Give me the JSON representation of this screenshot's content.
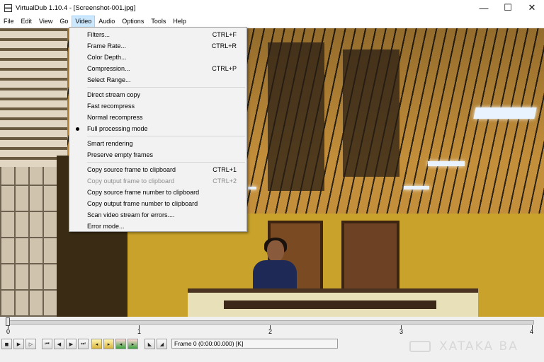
{
  "window": {
    "title": "VirtualDub 1.10.4 - [Screenshot-001.jpg]",
    "controls": {
      "minimize": "—",
      "maximize": "☐",
      "close": "✕"
    }
  },
  "menubar": {
    "items": [
      "File",
      "Edit",
      "View",
      "Go",
      "Video",
      "Audio",
      "Options",
      "Tools",
      "Help"
    ],
    "active": "Video"
  },
  "video_menu": {
    "groups": [
      [
        {
          "label": "Filters...",
          "shortcut": "CTRL+F"
        },
        {
          "label": "Frame Rate...",
          "shortcut": "CTRL+R"
        },
        {
          "label": "Color Depth...",
          "shortcut": ""
        },
        {
          "label": "Compression...",
          "shortcut": "CTRL+P"
        },
        {
          "label": "Select Range...",
          "shortcut": ""
        }
      ],
      [
        {
          "label": "Direct stream copy",
          "shortcut": ""
        },
        {
          "label": "Fast recompress",
          "shortcut": ""
        },
        {
          "label": "Normal recompress",
          "shortcut": ""
        },
        {
          "label": "Full processing mode",
          "shortcut": "",
          "checked": true
        }
      ],
      [
        {
          "label": "Smart rendering",
          "shortcut": ""
        },
        {
          "label": "Preserve empty frames",
          "shortcut": ""
        }
      ],
      [
        {
          "label": "Copy source frame to clipboard",
          "shortcut": "CTRL+1"
        },
        {
          "label": "Copy output frame to clipboard",
          "shortcut": "CTRL+2",
          "disabled": true
        },
        {
          "label": "Copy source frame number to clipboard",
          "shortcut": ""
        },
        {
          "label": "Copy output frame number to clipboard",
          "shortcut": ""
        },
        {
          "label": "Scan video stream for errors....",
          "shortcut": ""
        },
        {
          "label": "Error mode...",
          "shortcut": ""
        }
      ]
    ]
  },
  "timeline": {
    "labels": [
      "0",
      "1",
      "2",
      "3",
      "4"
    ],
    "position": 0
  },
  "toolbar": {
    "frame_readout": "Frame 0 (0:00:00.000) [K]"
  },
  "watermark": {
    "text": "XATAKA BA"
  },
  "colors": {
    "menu_highlight": "#cce8ff",
    "video_bg": "#463716"
  }
}
